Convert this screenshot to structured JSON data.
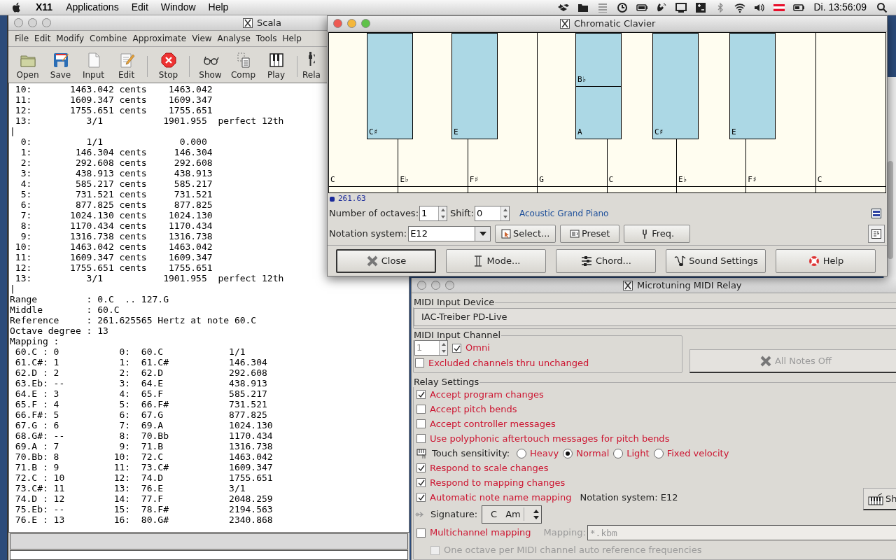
{
  "menubar": {
    "app": "X11",
    "menus": [
      "Applications",
      "Edit",
      "Window",
      "Help"
    ],
    "clock": "Di. 13:56:09"
  },
  "scala": {
    "title": "Scala",
    "menus": [
      "File",
      "Edit",
      "Modify",
      "Combine",
      "Approximate",
      "View",
      "Analyse",
      "Tools",
      "Help"
    ],
    "toolbar": [
      "Open",
      "Save",
      "Input",
      "Edit",
      "Stop",
      "Show",
      "Comp",
      "Play",
      "Rela"
    ],
    "lines": [
      " 10:       1463.042 cents    1463.042",
      " 11:       1609.347 cents    1609.347",
      " 12:       1755.651 cents    1755.651",
      " 13:          3/1           1901.955  perfect 12th",
      "|",
      "  0:          1/1              0.000",
      "  1:        146.304 cents     146.304",
      "  2:        292.608 cents     292.608",
      "  3:        438.913 cents     438.913",
      "  4:        585.217 cents     585.217",
      "  5:        731.521 cents     731.521",
      "  6:        877.825 cents     877.825",
      "  7:       1024.130 cents    1024.130",
      "  8:       1170.434 cents    1170.434",
      "  9:       1316.738 cents    1316.738",
      " 10:       1463.042 cents    1463.042",
      " 11:       1609.347 cents    1609.347",
      " 12:       1755.651 cents    1755.651",
      " 13:          3/1           1901.955  perfect 12th",
      "|",
      "Range         : 0.C  .. 127.G",
      "Middle        : 60.C",
      "Reference     : 261.625565 Hertz at note 60.C",
      "Octave degree : 13",
      "Mapping :",
      " 60.C : 0           0:  60.C            1/1",
      " 61.C#: 1           1:  61.C#           146.304",
      " 62.D : 2           2:  62.D            292.608",
      " 63.Eb: --          3:  64.E            438.913",
      " 64.E : 3           4:  65.F            585.217",
      " 65.F : 4           5:  66.F#           731.521",
      " 66.F#: 5           6:  67.G            877.825",
      " 67.G : 6           7:  69.A            1024.130",
      " 68.G#: --          8:  70.Bb           1170.434",
      " 69.A : 7           9:  71.B            1316.738",
      " 70.Bb: 8          10:  72.C            1463.042",
      " 71.B : 9          11:  73.C#           1609.347",
      " 72.C : 10         12:  74.D            1755.651",
      " 73.C#: 11         13:  76.E            3/1",
      " 74.D : 12         14:  77.F            2048.259",
      " 75.Eb: --         15:  78.F#           2194.563",
      " 76.E : 13         16:  80.G#           2340.868"
    ]
  },
  "clavier": {
    "title": "Chromatic Clavier",
    "white_keys": [
      "C",
      "E♭",
      "F♯",
      "G",
      "C",
      "E♭",
      "F♯",
      "C"
    ],
    "black_keys": [
      {
        "labels": [
          "C♯"
        ]
      },
      {
        "labels": [
          "E"
        ]
      },
      {
        "labels": [
          "B♭",
          "A"
        ]
      },
      {
        "labels": [
          "C♯"
        ]
      },
      {
        "labels": [
          "E"
        ]
      }
    ],
    "frequency": "261.63",
    "octaves": {
      "label": "Number of octaves:",
      "value": "1"
    },
    "shift": {
      "label": "Shift:",
      "value": "0"
    },
    "instrument": "Acoustic Grand Piano",
    "notation": {
      "label": "Notation system:",
      "value": "E12"
    },
    "tool_buttons": [
      "Select...",
      "Preset",
      "Freq."
    ],
    "buttons": [
      "Close",
      "Mode...",
      "Chord...",
      "Sound Settings",
      "Help"
    ]
  },
  "relay": {
    "title": "Microtuning MIDI Relay",
    "input_device": {
      "legend": "MIDI Input Device",
      "value": "IAC-Treiber PD-Live"
    },
    "input_channel": {
      "legend": "MIDI Input Channel",
      "channel": {
        "value": "1",
        "disabled": true
      },
      "omni": {
        "label": "Omni",
        "checked": true
      },
      "excluded": {
        "label": "Excluded channels thru unchanged",
        "checked": false
      }
    },
    "all_notes_off": {
      "label": "All Notes Off",
      "disabled": true
    },
    "settings": {
      "legend": "Relay Settings",
      "rows": [
        {
          "kind": "checkbox",
          "label": "Accept program changes",
          "checked": true,
          "disabled": false
        },
        {
          "kind": "checkbox",
          "label": "Accept pitch bends",
          "checked": false,
          "disabled": false
        },
        {
          "kind": "checkbox",
          "label": "Accept controller messages",
          "checked": false,
          "disabled": false
        },
        {
          "kind": "checkbox",
          "label": "Use polyphonic aftertouch messages for pitch bends",
          "checked": false,
          "disabled": false
        },
        {
          "kind": "radio",
          "label": "Touch sensitivity:",
          "options": [
            {
              "label": "Heavy",
              "selected": false
            },
            {
              "label": "Normal",
              "selected": true
            },
            {
              "label": "Light",
              "selected": false
            },
            {
              "label": "Fixed velocity",
              "selected": false
            }
          ]
        },
        {
          "kind": "checkbox",
          "label": "Respond to scale changes",
          "checked": true,
          "disabled": false
        },
        {
          "kind": "checkbox",
          "label": "Respond to mapping changes",
          "checked": true,
          "disabled": false
        },
        {
          "kind": "checkbox",
          "label": "Automatic note name mapping",
          "checked": true,
          "disabled": false,
          "note": "Notation system: E12"
        },
        {
          "kind": "signature",
          "label": "Signature:",
          "key": "C",
          "mode": "Am"
        },
        {
          "kind": "mapping",
          "label": "Multichannel mapping",
          "checked": false,
          "field_label": "Mapping:",
          "field_value": "*.kbm",
          "field_disabled": true
        },
        {
          "kind": "checkbox",
          "label": "One octave per MIDI channel auto reference frequencies",
          "checked": false,
          "disabled": true
        }
      ]
    },
    "side_button": "Sh"
  }
}
